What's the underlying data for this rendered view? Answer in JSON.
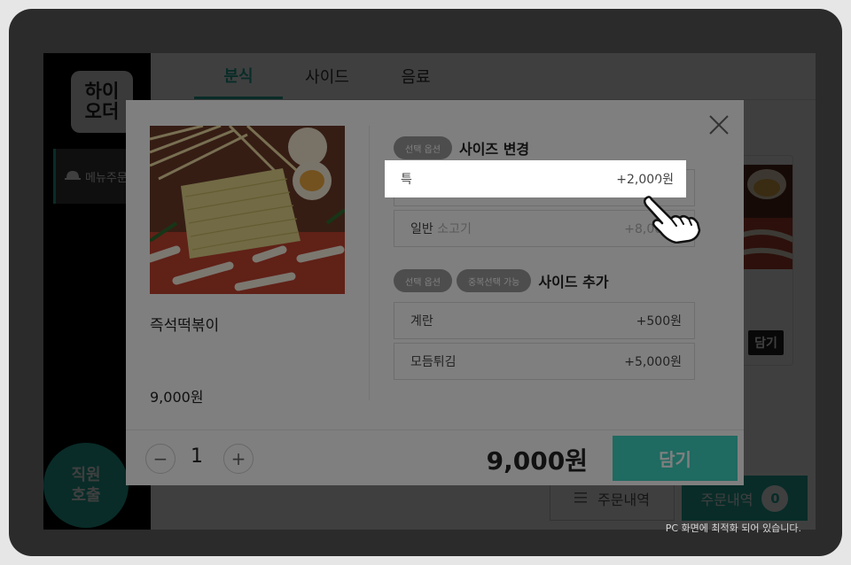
{
  "sidebar": {
    "logo": "하이\n오더",
    "menu_label": "메뉴주문",
    "staff_call": "직원\n호출"
  },
  "tabs": [
    {
      "label": "분식",
      "active": true
    },
    {
      "label": "사이드",
      "active": false
    },
    {
      "label": "음료",
      "active": false
    }
  ],
  "background": {
    "put_label": "담기",
    "order_history_label": "주문내역",
    "order_history_label_2": "주문내역",
    "order_count": "0"
  },
  "modal": {
    "product_name": "즉석떡볶이",
    "product_price": "9,000원",
    "size_group": {
      "badge": "선택 옵션",
      "title": "사이즈 변경",
      "options": [
        {
          "name": "특",
          "price": "+2,000원",
          "highlighted": true
        },
        {
          "name": "일반",
          "name_suffix": "소고기",
          "price": "+8,000원",
          "highlighted": false
        }
      ]
    },
    "side_group": {
      "badge": "선택 옵션",
      "badge2": "중복선택 가능",
      "title": "사이드 추가",
      "options": [
        {
          "name": "계란",
          "price": "+500원"
        },
        {
          "name": "모듬튀김",
          "price": "+5,000원"
        }
      ]
    },
    "quantity": "1",
    "minus": "−",
    "plus": "+",
    "total": "9,000원",
    "put_button": "담기"
  },
  "footnote": "PC 화면에 최적화 되어 있습니다.",
  "colors": {
    "accent": "#24b3a2",
    "accent_light": "#3fd4c2"
  },
  "icons": [
    "bell-icon",
    "close-icon",
    "hamburger-icon",
    "pointing-hand-icon"
  ]
}
